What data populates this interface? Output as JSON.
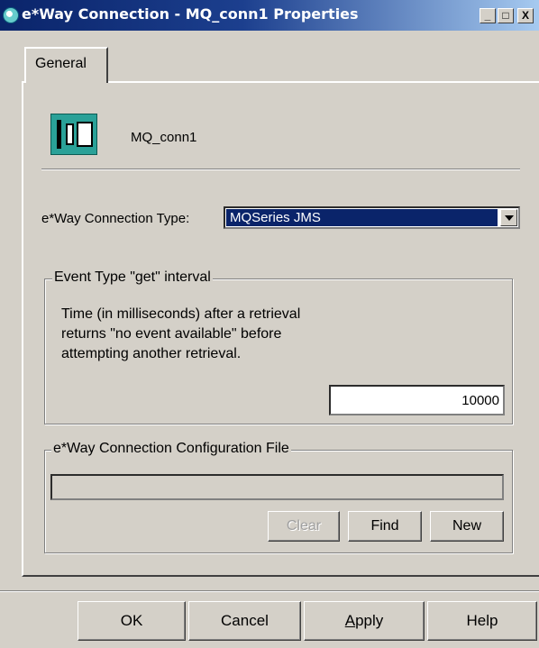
{
  "window": {
    "title": "e*Way Connection - MQ_conn1 Properties",
    "controls": [
      "_",
      "□",
      "X"
    ]
  },
  "tabs": [
    {
      "label": "General",
      "selected": true
    }
  ],
  "general": {
    "connection_name": "MQ_conn1",
    "connection_type_label": "e*Way Connection Type:",
    "connection_type_value": "MQSeries JMS"
  },
  "interval_group": {
    "legend": "Event Type \"get\" interval",
    "description_lines": [
      "Time (in milliseconds) after a retrieval",
      "returns \"no event available\" before",
      "attempting another retrieval."
    ],
    "value": "10000"
  },
  "config_group": {
    "legend": "e*Way Connection Configuration File",
    "file_value": "",
    "clear_label": "Clear",
    "find_label": "Find",
    "new_label": "New"
  },
  "footer": {
    "ok_label": "OK",
    "cancel_label": "Cancel",
    "apply_label": "Apply",
    "help_label": "Help"
  }
}
